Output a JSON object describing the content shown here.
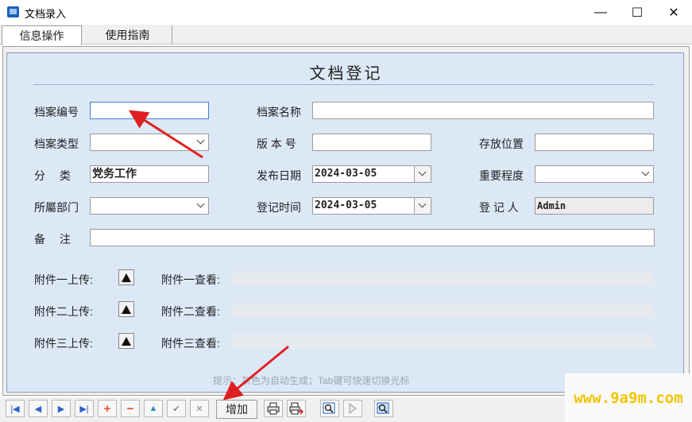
{
  "window": {
    "title": "文档录入",
    "minimize": "—",
    "maximize": "☐",
    "close": "✕"
  },
  "tabs": [
    {
      "label": "信息操作"
    },
    {
      "label": "使用指南"
    }
  ],
  "form": {
    "title": "文档登记",
    "labels": {
      "archive_no": "档案编号",
      "archive_name": "档案名称",
      "archive_type": "档案类型",
      "version": "版 本 号",
      "location": "存放位置",
      "category": "分　 类",
      "publish_date": "发布日期",
      "importance": "重要程度",
      "department": "所屬部门",
      "register_time": "登记时间",
      "registrant": "登 记 人",
      "remark": "备　 注"
    },
    "values": {
      "archive_no": "",
      "archive_name": "",
      "archive_type": "",
      "version": "",
      "location": "",
      "category": "党务工作",
      "publish_date": "2024-03-05",
      "importance": "",
      "department": "",
      "register_time": "2024-03-05",
      "registrant": "Admin",
      "remark": ""
    },
    "attachments": [
      {
        "upload_label": "附件一上传:",
        "view_label": "附件一查看:"
      },
      {
        "upload_label": "附件二上传:",
        "view_label": "附件二查看:"
      },
      {
        "upload_label": "附件三上传:",
        "view_label": "附件三查看:"
      }
    ],
    "hint": "提示：灰色为自动生成；Tab键可快速切换光标"
  },
  "toolbar": {
    "first": "|◀",
    "prev": "◀",
    "next": "▶",
    "last": "▶|",
    "add_record": "+",
    "delete_record": "−",
    "edit": "▲",
    "confirm": "✔",
    "cancel": "✕",
    "add_label": "增加"
  },
  "watermark": "www.9a9m.com",
  "colors": {
    "panel_bg": "#dde8f7",
    "focus_border": "#3c7fd6",
    "annotation_arrow": "#e02020"
  }
}
